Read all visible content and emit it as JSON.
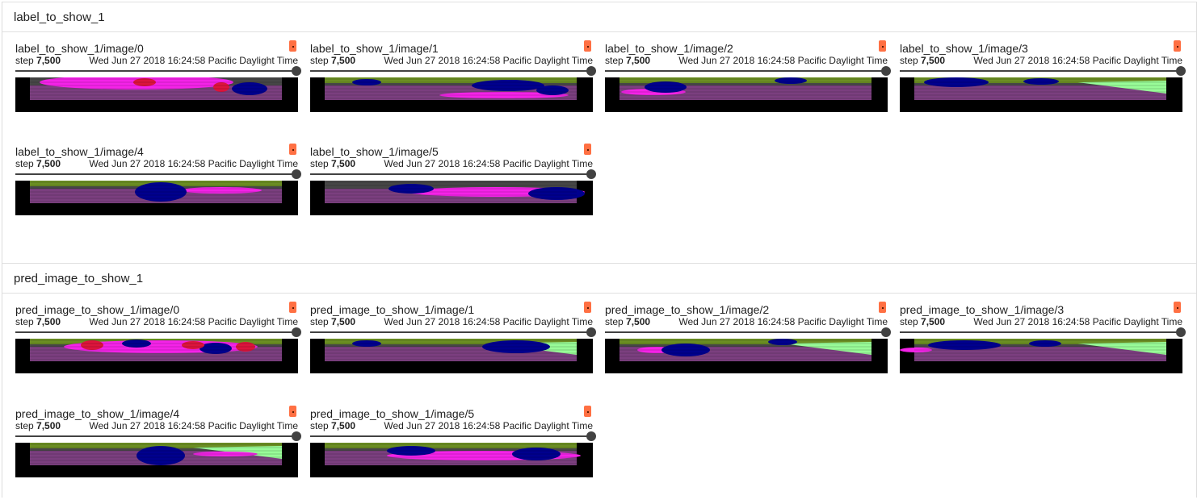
{
  "colors": {
    "badge": "#ff7043",
    "slider": "#424242",
    "seg_road": "#7b3f7f",
    "seg_vegetation": "#6b8e23",
    "seg_car": "#00008e",
    "seg_sidewalk": "#f423e8",
    "seg_person": "#dc143c",
    "seg_building": "#464646",
    "seg_terrain": "#98fb98",
    "seg_void": "#000000"
  },
  "sections": [
    {
      "title": "label_to_show_1",
      "cards": [
        {
          "title": "label_to_show_1/image/0",
          "step_label": "step",
          "step": "7,500",
          "timestamp": "Wed Jun 27 2018 16:24:58 Pacific Daylight Time",
          "icon": "info-badge-icon"
        },
        {
          "title": "label_to_show_1/image/1",
          "step_label": "step",
          "step": "7,500",
          "timestamp": "Wed Jun 27 2018 16:24:58 Pacific Daylight Time",
          "icon": "info-badge-icon"
        },
        {
          "title": "label_to_show_1/image/2",
          "step_label": "step",
          "step": "7,500",
          "timestamp": "Wed Jun 27 2018 16:24:58 Pacific Daylight Time",
          "icon": "info-badge-icon"
        },
        {
          "title": "label_to_show_1/image/3",
          "step_label": "step",
          "step": "7,500",
          "timestamp": "Wed Jun 27 2018 16:24:58 Pacific Daylight Time",
          "icon": "info-badge-icon"
        },
        {
          "title": "label_to_show_1/image/4",
          "step_label": "step",
          "step": "7,500",
          "timestamp": "Wed Jun 27 2018 16:24:58 Pacific Daylight Time",
          "icon": "info-badge-icon"
        },
        {
          "title": "label_to_show_1/image/5",
          "step_label": "step",
          "step": "7,500",
          "timestamp": "Wed Jun 27 2018 16:24:58 Pacific Daylight Time",
          "icon": "info-badge-icon"
        }
      ]
    },
    {
      "title": "pred_image_to_show_1",
      "cards": [
        {
          "title": "pred_image_to_show_1/image/0",
          "step_label": "step",
          "step": "7,500",
          "timestamp": "Wed Jun 27 2018 16:24:58 Pacific Daylight Time",
          "icon": "info-badge-icon"
        },
        {
          "title": "pred_image_to_show_1/image/1",
          "step_label": "step",
          "step": "7,500",
          "timestamp": "Wed Jun 27 2018 16:24:58 Pacific Daylight Time",
          "icon": "info-badge-icon"
        },
        {
          "title": "pred_image_to_show_1/image/2",
          "step_label": "step",
          "step": "7,500",
          "timestamp": "Wed Jun 27 2018 16:24:58 Pacific Daylight Time",
          "icon": "info-badge-icon"
        },
        {
          "title": "pred_image_to_show_1/image/3",
          "step_label": "step",
          "step": "7,500",
          "timestamp": "Wed Jun 27 2018 16:24:58 Pacific Daylight Time",
          "icon": "info-badge-icon"
        },
        {
          "title": "pred_image_to_show_1/image/4",
          "step_label": "step",
          "step": "7,500",
          "timestamp": "Wed Jun 27 2018 16:24:58 Pacific Daylight Time",
          "icon": "info-badge-icon"
        },
        {
          "title": "pred_image_to_show_1/image/5",
          "step_label": "step",
          "step": "7,500",
          "timestamp": "Wed Jun 27 2018 16:24:58 Pacific Daylight Time",
          "icon": "info-badge-icon"
        }
      ]
    }
  ]
}
